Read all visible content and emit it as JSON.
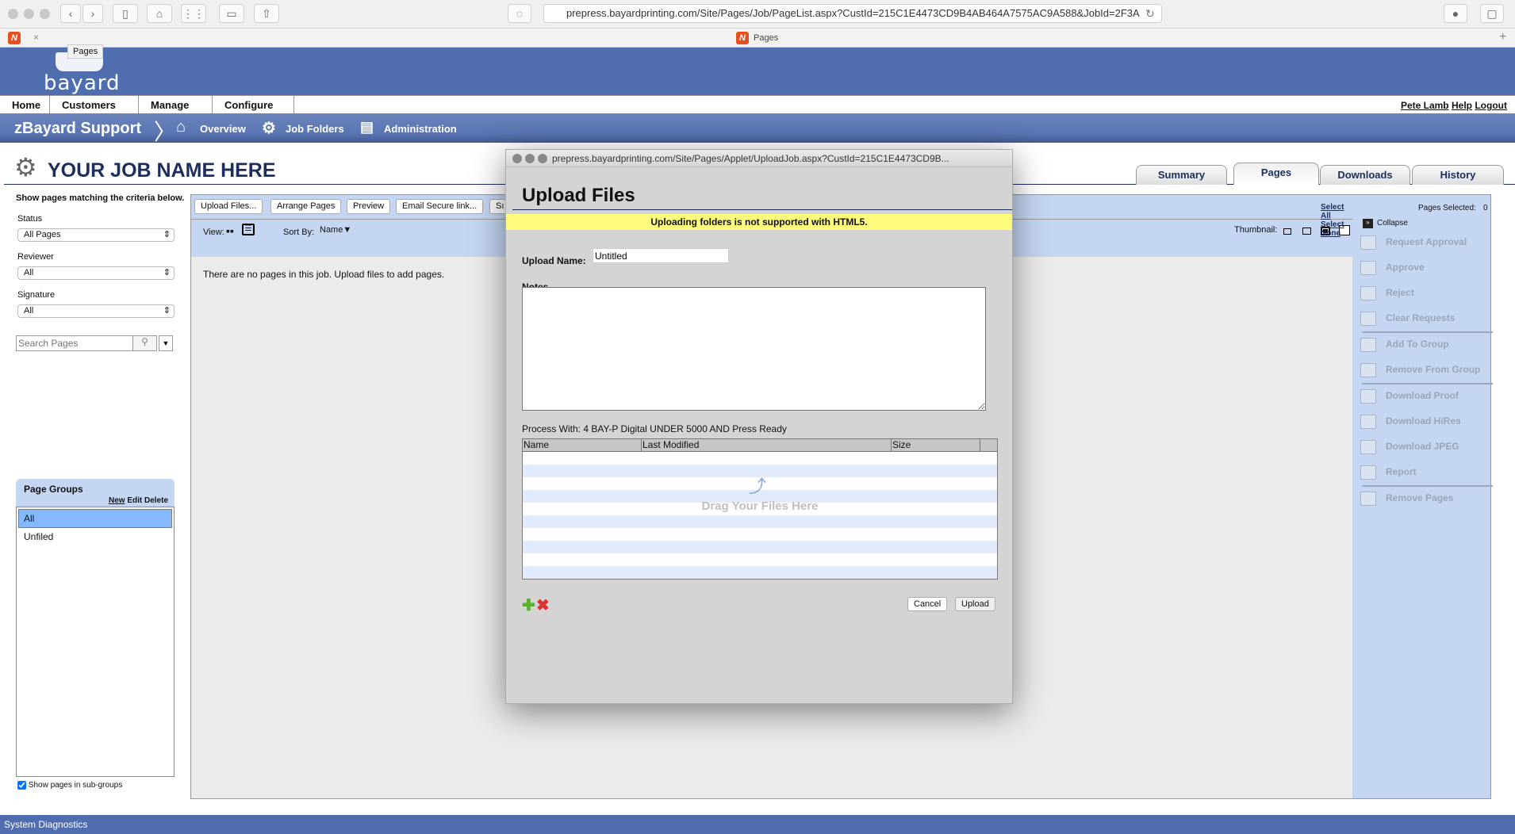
{
  "browser": {
    "url": "prepress.bayardprinting.com/Site/Pages/Job/PageList.aspx?CustId=215C1E4473CD9B4AB464A7575AC9A588&JobId=2F3A",
    "tab_title": "Pages",
    "tooltip": "Pages",
    "close": "×",
    "new_tab": "+"
  },
  "brand": {
    "logo": "bayard"
  },
  "menu": {
    "items": [
      "Home",
      "Customers ▼",
      "Manage ▼",
      "Configure ▼"
    ],
    "user": "Pete Lamb",
    "help": "Help",
    "logout": "Logout"
  },
  "subnav": {
    "title": "zBayard Support",
    "overview": "Overview",
    "job_folders": "Job Folders",
    "administration": "Administration"
  },
  "job": {
    "title": "YOUR JOB NAME HERE"
  },
  "tabs": [
    "Summary",
    "Pages",
    "Downloads",
    "History"
  ],
  "filters": {
    "intro": "Show pages matching the criteria below.",
    "status_label": "Status",
    "status_value": "All Pages",
    "reviewer_label": "Reviewer",
    "reviewer_value": "All",
    "signature_label": "Signature",
    "signature_value": "All",
    "search_placeholder": "Search Pages"
  },
  "groups": {
    "title": "Page Groups",
    "new": "New",
    "edit": "Edit",
    "delete": "Delete",
    "items": [
      "All",
      "Unfiled"
    ],
    "subgroups_label": "Show pages in sub-groups",
    "subgroups_checked": true
  },
  "toolbar": {
    "buttons": [
      "Upload Files...",
      "Arrange Pages",
      "Preview",
      "Email Secure link...",
      "Sı"
    ],
    "view_label": "View:",
    "sort_label": "Sort By:",
    "sort_value": "Name",
    "thumbnail_label": "Thumbnail:",
    "select_all": "Select All",
    "select_none": "Select None",
    "pages_selected_label": "Pages Selected:",
    "pages_selected": "0"
  },
  "empty_message": "There are no pages in this job.  Upload files to add pages.",
  "actions": {
    "collapse": "Collapse",
    "items": [
      "Request Approval",
      "Approve",
      "Reject",
      "Clear Requests",
      "Add To Group",
      "Remove From Group",
      "Download Proof",
      "Download HiRes",
      "Download JPEG",
      "Report",
      "Remove Pages"
    ]
  },
  "dialog": {
    "url": "prepress.bayardprinting.com/Site/Pages/Applet/UploadJob.aspx?CustId=215C1E4473CD9B...",
    "title": "Upload Files",
    "warning": "Uploading folders is not supported with HTML5.",
    "upload_name_label": "Upload Name:",
    "upload_name_value": "Untitled",
    "notes_label": "Notes",
    "process_with": "Process With: 4 BAY-P Digital UNDER 5000 AND Press Ready",
    "columns": [
      "Name",
      "Last Modified",
      "Size"
    ],
    "drop_text": "Drag Your Files Here",
    "cancel": "Cancel",
    "upload": "Upload",
    "warning_color": "#fdfc7f"
  },
  "footer": {
    "label": "System Diagnostics"
  }
}
